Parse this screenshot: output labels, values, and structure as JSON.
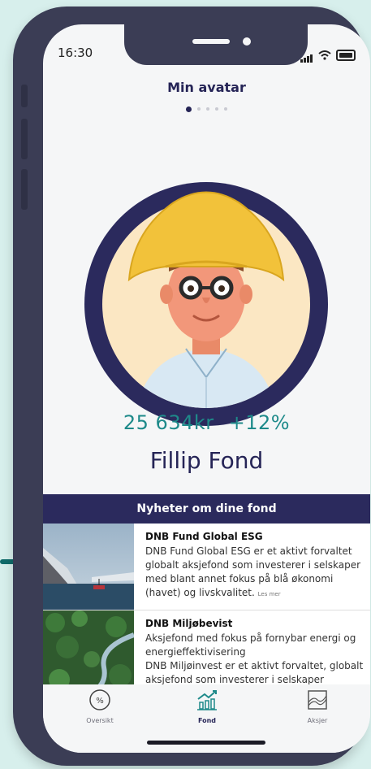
{
  "status_bar": {
    "time": "16:30"
  },
  "header": {
    "title": "Min avatar",
    "page_dots": 5,
    "active_dot": 0
  },
  "portfolio": {
    "value": "25 634kr",
    "change": "+12%",
    "name": "Fillip Fond"
  },
  "news": {
    "heading": "Nyheter om dine fond",
    "items": [
      {
        "title": "DNB Fund Global ESG",
        "body": "DNB Fund Global ESG er et aktivt forvaltet globalt aksjefond som investerer i selskaper med blant annet fokus på blå økonomi (havet) og livskvalitet.",
        "more": "Les mer"
      },
      {
        "title": "DNB Miljøbevist",
        "body": "Aksjefond med fokus på fornybar energi og energieffektivisering",
        "body2": "DNB Miljøinvest er et aktivt forvaltet, globalt aksjefond som investerer i selskaper"
      }
    ]
  },
  "tabs": [
    {
      "label": "Oversikt",
      "icon": "percent-circle-icon"
    },
    {
      "label": "Fond",
      "icon": "chart-trend-icon",
      "active": true
    },
    {
      "label": "Aksjer",
      "icon": "area-chart-icon"
    }
  ],
  "colors": {
    "navy": "#2b2a5d",
    "teal": "#1e8a8a",
    "hat": "#f2c23a"
  }
}
